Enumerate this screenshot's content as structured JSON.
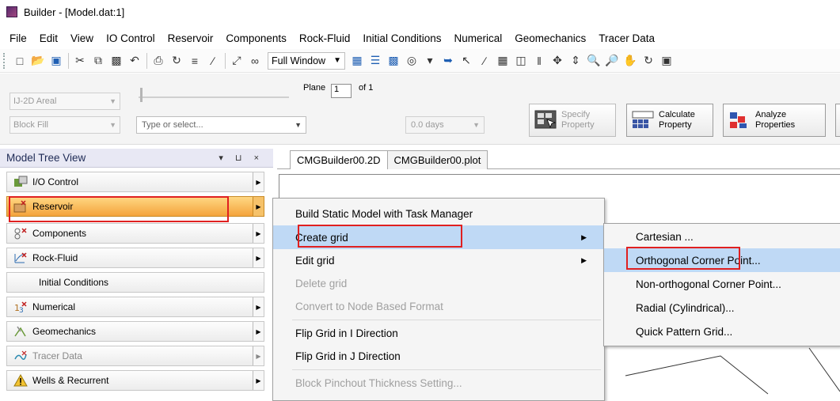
{
  "window": {
    "title": "Builder - [Model.dat:1]"
  },
  "menubar": {
    "items": [
      "File",
      "Edit",
      "View",
      "IO Control",
      "Reservoir",
      "Components",
      "Rock-Fluid",
      "Initial Conditions",
      "Numerical",
      "Geomechanics",
      "Tracer Data"
    ]
  },
  "toolbar": {
    "view_combo": "Full Window"
  },
  "ribbon": {
    "view_type": "IJ-2D Areal",
    "fill_mode": "Block Fill",
    "plane_label": "Plane",
    "plane_value": "1",
    "of_label": "of 1",
    "property_select_placeholder": "Type or select...",
    "time_combo": "0.0 days",
    "specify_property": {
      "line1": "Specify",
      "line2": "Property"
    },
    "calculate_property": {
      "line1": "Calculate",
      "line2": "Property"
    },
    "analyze_properties": {
      "line1": "Analyze",
      "line2": "Properties"
    }
  },
  "tree": {
    "title": "Model Tree View",
    "controls": "▾ ⊔ ×",
    "items": [
      {
        "label": "I/O Control",
        "icon": "io-control-icon"
      },
      {
        "label": "Reservoir",
        "icon": "reservoir-icon"
      },
      {
        "label": "Components",
        "icon": "components-icon"
      },
      {
        "label": "Rock-Fluid",
        "icon": "rock-fluid-icon"
      },
      {
        "label": "Initial Conditions",
        "icon": ""
      },
      {
        "label": "Numerical",
        "icon": "numerical-icon"
      },
      {
        "label": "Geomechanics",
        "icon": "geomechanics-icon"
      },
      {
        "label": "Tracer Data",
        "icon": "tracer-data-icon"
      },
      {
        "label": "Wells & Recurrent",
        "icon": "warning-icon"
      }
    ]
  },
  "doc_tabs": [
    "CMGBuilder00.2D",
    "CMGBuilder00.plot"
  ],
  "context_menu": {
    "items": [
      {
        "label": "Build Static Model with Task Manager",
        "enabled": true
      },
      {
        "label": "Create grid",
        "enabled": true,
        "submenu": true
      },
      {
        "label": "Edit grid",
        "enabled": true,
        "submenu": true
      },
      {
        "label": "Delete grid",
        "enabled": false
      },
      {
        "label": "Convert to Node Based Format",
        "enabled": false
      },
      {
        "label": "Flip Grid in I Direction",
        "enabled": true
      },
      {
        "label": "Flip Grid in J Direction",
        "enabled": true
      },
      {
        "label": "Block Pinchout Thickness Setting...",
        "enabled": false
      }
    ]
  },
  "submenu": {
    "items": [
      "Cartesian ...",
      "Orthogonal Corner Point...",
      "Non-orthogonal Corner Point...",
      "Radial (Cylindrical)...",
      "Quick Pattern Grid..."
    ]
  },
  "colors": {
    "selection_orange": "#f4a33b",
    "menu_hover": "#bfd9f5",
    "highlight_red": "#e02020"
  }
}
